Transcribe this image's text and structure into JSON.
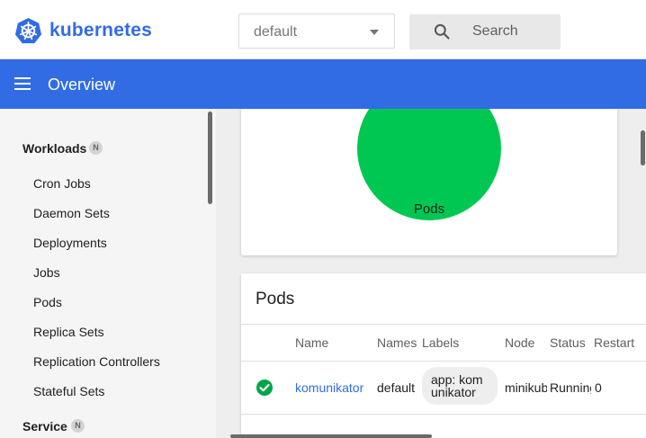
{
  "header": {
    "brand": "kubernetes",
    "namespace": "default",
    "search_placeholder": "Search"
  },
  "toolbar": {
    "title": "Overview"
  },
  "sidebar": {
    "workloads_label": "Workloads",
    "workloads_badge": "N",
    "items": [
      "Cron Jobs",
      "Daemon Sets",
      "Deployments",
      "Jobs",
      "Pods",
      "Replica Sets",
      "Replication Controllers",
      "Stateful Sets"
    ],
    "service_label": "Service",
    "service_badge": "N"
  },
  "status_chart": {
    "label": "Pods",
    "color": "#00c752"
  },
  "pods_table": {
    "title": "Pods",
    "columns": [
      "Name",
      "Names",
      "Labels",
      "Node",
      "Status",
      "Restart"
    ],
    "rows": [
      {
        "status_icon": "check-circle-icon",
        "name": "komunikator",
        "namespace": "default",
        "label_line1": "app: kom",
        "label_line2": "unikator",
        "node": "minikube",
        "status": "Running",
        "restarts": "0"
      }
    ]
  },
  "colors": {
    "brand": "#326ce5",
    "success": "#00c752"
  }
}
